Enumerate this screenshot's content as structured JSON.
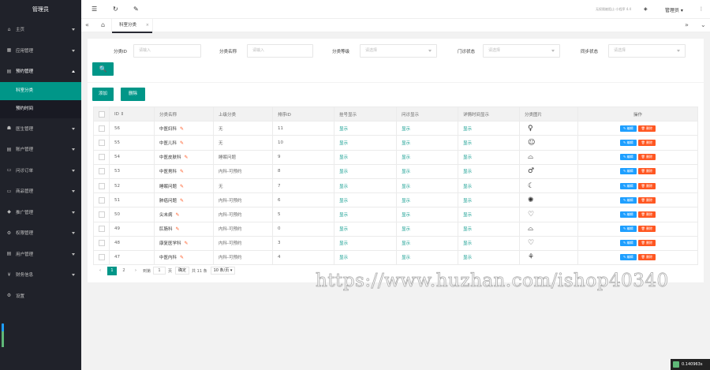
{
  "sidebar": {
    "brand": "管理员",
    "items": [
      {
        "icon": "home-icon",
        "glyph": "⌂",
        "label": "主页"
      },
      {
        "icon": "app-icon",
        "glyph": "▦",
        "label": "应用管理"
      },
      {
        "icon": "appointment-icon",
        "glyph": "▤",
        "label": "预约管理"
      },
      {
        "icon": "doctor-icon",
        "glyph": "☗",
        "label": "医生管理"
      },
      {
        "icon": "finance-icon",
        "glyph": "▤",
        "label": "账户管理"
      },
      {
        "icon": "consult-order-icon",
        "glyph": "▭",
        "label": "问诊订单"
      },
      {
        "icon": "product-icon",
        "glyph": "▭",
        "label": "商品管理"
      },
      {
        "icon": "promotion-icon",
        "glyph": "◆",
        "label": "推广管理"
      },
      {
        "icon": "permission-icon",
        "glyph": "⚙",
        "label": "权限管理"
      },
      {
        "icon": "user-icon",
        "glyph": "▤",
        "label": "用户管理"
      },
      {
        "icon": "finance-info-icon",
        "glyph": "¥",
        "label": "财务信息"
      },
      {
        "icon": "settings-icon",
        "glyph": "⚙",
        "label": "设置"
      }
    ],
    "sub_items": [
      "科室分类",
      "预约时间"
    ]
  },
  "header": {
    "notice": "无权限被阻止-小程序 4.4",
    "user": "管理员 ▾"
  },
  "tabs": {
    "active": "科室分类",
    "close": "×"
  },
  "filters": [
    {
      "label": "分类ID",
      "placeholder": "请输入"
    },
    {
      "label": "分类名称",
      "placeholder": "请输入"
    },
    {
      "label": "分类等级",
      "placeholder": "请选择"
    },
    {
      "label": "门诊状态",
      "placeholder": "请选择"
    },
    {
      "label": "同步状态",
      "placeholder": "请选择"
    }
  ],
  "buttons": {
    "add": "添加",
    "delete": "删除",
    "search": "🔍"
  },
  "table": {
    "headers": [
      "ID ⇕",
      "分类名称",
      "上级分类",
      "排序ID",
      "挂号显示",
      "问诊显示",
      "详情时间显示",
      "分类图片",
      "操作"
    ],
    "edit_label": "✎ 编辑",
    "delete_label": "🗑 删除",
    "rows": [
      {
        "id": "56",
        "name": "中医妇科",
        "parent": "无",
        "sort": "11",
        "reg": "显示",
        "consult": "显示",
        "detail": "显示",
        "icon": "female-doctor-icon",
        "glyph": "♀"
      },
      {
        "id": "55",
        "name": "中医儿科",
        "parent": "无",
        "sort": "10",
        "reg": "显示",
        "consult": "显示",
        "detail": "显示",
        "icon": "child-face-icon",
        "glyph": "☺"
      },
      {
        "id": "54",
        "name": "中医皮肤科",
        "parent": "睡眠问题",
        "sort": "9",
        "reg": "显示",
        "consult": "显示",
        "detail": "显示",
        "icon": "skin-icon",
        "glyph": "⌓"
      },
      {
        "id": "53",
        "name": "中医男科",
        "parent": "内科-可预约",
        "sort": "8",
        "reg": "显示",
        "consult": "显示",
        "detail": "显示",
        "icon": "male-doctor-icon",
        "glyph": "♂"
      },
      {
        "id": "52",
        "name": "睡眠问题",
        "parent": "无",
        "sort": "7",
        "reg": "显示",
        "consult": "显示",
        "detail": "显示",
        "icon": "moon-icon",
        "glyph": "☾"
      },
      {
        "id": "51",
        "name": "肺癌问题",
        "parent": "内科-可预约",
        "sort": "6",
        "reg": "显示",
        "consult": "显示",
        "detail": "显示",
        "icon": "virus-icon",
        "glyph": "✺"
      },
      {
        "id": "50",
        "name": "尖未病",
        "parent": "内科-可预约",
        "sort": "5",
        "reg": "显示",
        "consult": "显示",
        "detail": "显示",
        "icon": "stomach-icon",
        "glyph": "♡"
      },
      {
        "id": "49",
        "name": "肛肠科",
        "parent": "内科-可预约",
        "sort": "0",
        "reg": "显示",
        "consult": "显示",
        "detail": "显示",
        "icon": "intestine-icon",
        "glyph": "⌓"
      },
      {
        "id": "48",
        "name": "康复医学科",
        "parent": "内科-可预约",
        "sort": "3",
        "reg": "显示",
        "consult": "显示",
        "detail": "显示",
        "icon": "heart-pulse-icon",
        "glyph": "♡"
      },
      {
        "id": "47",
        "name": "中医内科",
        "parent": "内科-可预约",
        "sort": "4",
        "reg": "显示",
        "consult": "显示",
        "detail": "显示",
        "icon": "lungs-icon",
        "glyph": "⚘"
      }
    ]
  },
  "pager": {
    "prev": "‹",
    "pages": [
      "1",
      "2"
    ],
    "next": "›",
    "goto": "到第",
    "page_value": "1",
    "page_unit": "页",
    "confirm": "确定",
    "total": "共 11 条",
    "per_page": "10 条/页 ▾"
  },
  "watermark": "https://www.huzhan.com/ishop40340",
  "timer": "0.140963s",
  "colors": {
    "accent": "#009688",
    "sidebar": "#20222a",
    "edit": "#1e9fff",
    "danger": "#ff5722"
  }
}
